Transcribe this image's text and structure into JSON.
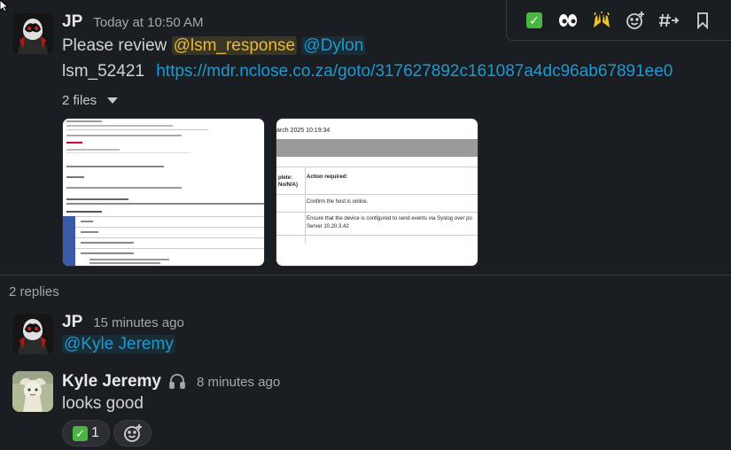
{
  "main_message": {
    "author": "JP",
    "time": "Today at 10:50 AM",
    "line1_prefix": "Please review",
    "mention_group": "@lsm_response",
    "mention_user": "@Dylon",
    "ticket": "lsm_52421",
    "url": "https://mdr.nclose.co.za/goto/317627892c161087a4dc96ab67891ee0",
    "files_label": "2 files"
  },
  "toolbar": {
    "items": [
      {
        "icon": "check-mark-emoji-icon",
        "glyph": "✅"
      },
      {
        "icon": "eyes-emoji-icon",
        "glyph": "👀"
      },
      {
        "icon": "raised-hands-emoji-icon",
        "glyph": "🙌"
      },
      {
        "icon": "add-reaction-icon",
        "glyph": "☺"
      },
      {
        "icon": "forward-channel-icon",
        "glyph": "#→"
      },
      {
        "icon": "bookmark-icon",
        "glyph": "🔖"
      }
    ]
  },
  "preview2": {
    "date_text": "arch 2025 10:19:34",
    "col1": "plete:\nNo/N/A)",
    "col2": "Action required:",
    "row1": "Confirm the host is online.",
    "row2": "Ensure that the device is configured to send events via Syslog over po Server 10.20.3.42"
  },
  "thread": {
    "replies_label": "2 replies",
    "reply1": {
      "author": "JP",
      "time": "15 minutes ago",
      "mention": "@Kyle Jeremy"
    },
    "reply2": {
      "author": "Kyle Jeremy",
      "status_icon": "headphones-icon",
      "time": "8 minutes ago",
      "text": "looks good",
      "reaction_emoji": "✅",
      "reaction_count": "1"
    }
  }
}
